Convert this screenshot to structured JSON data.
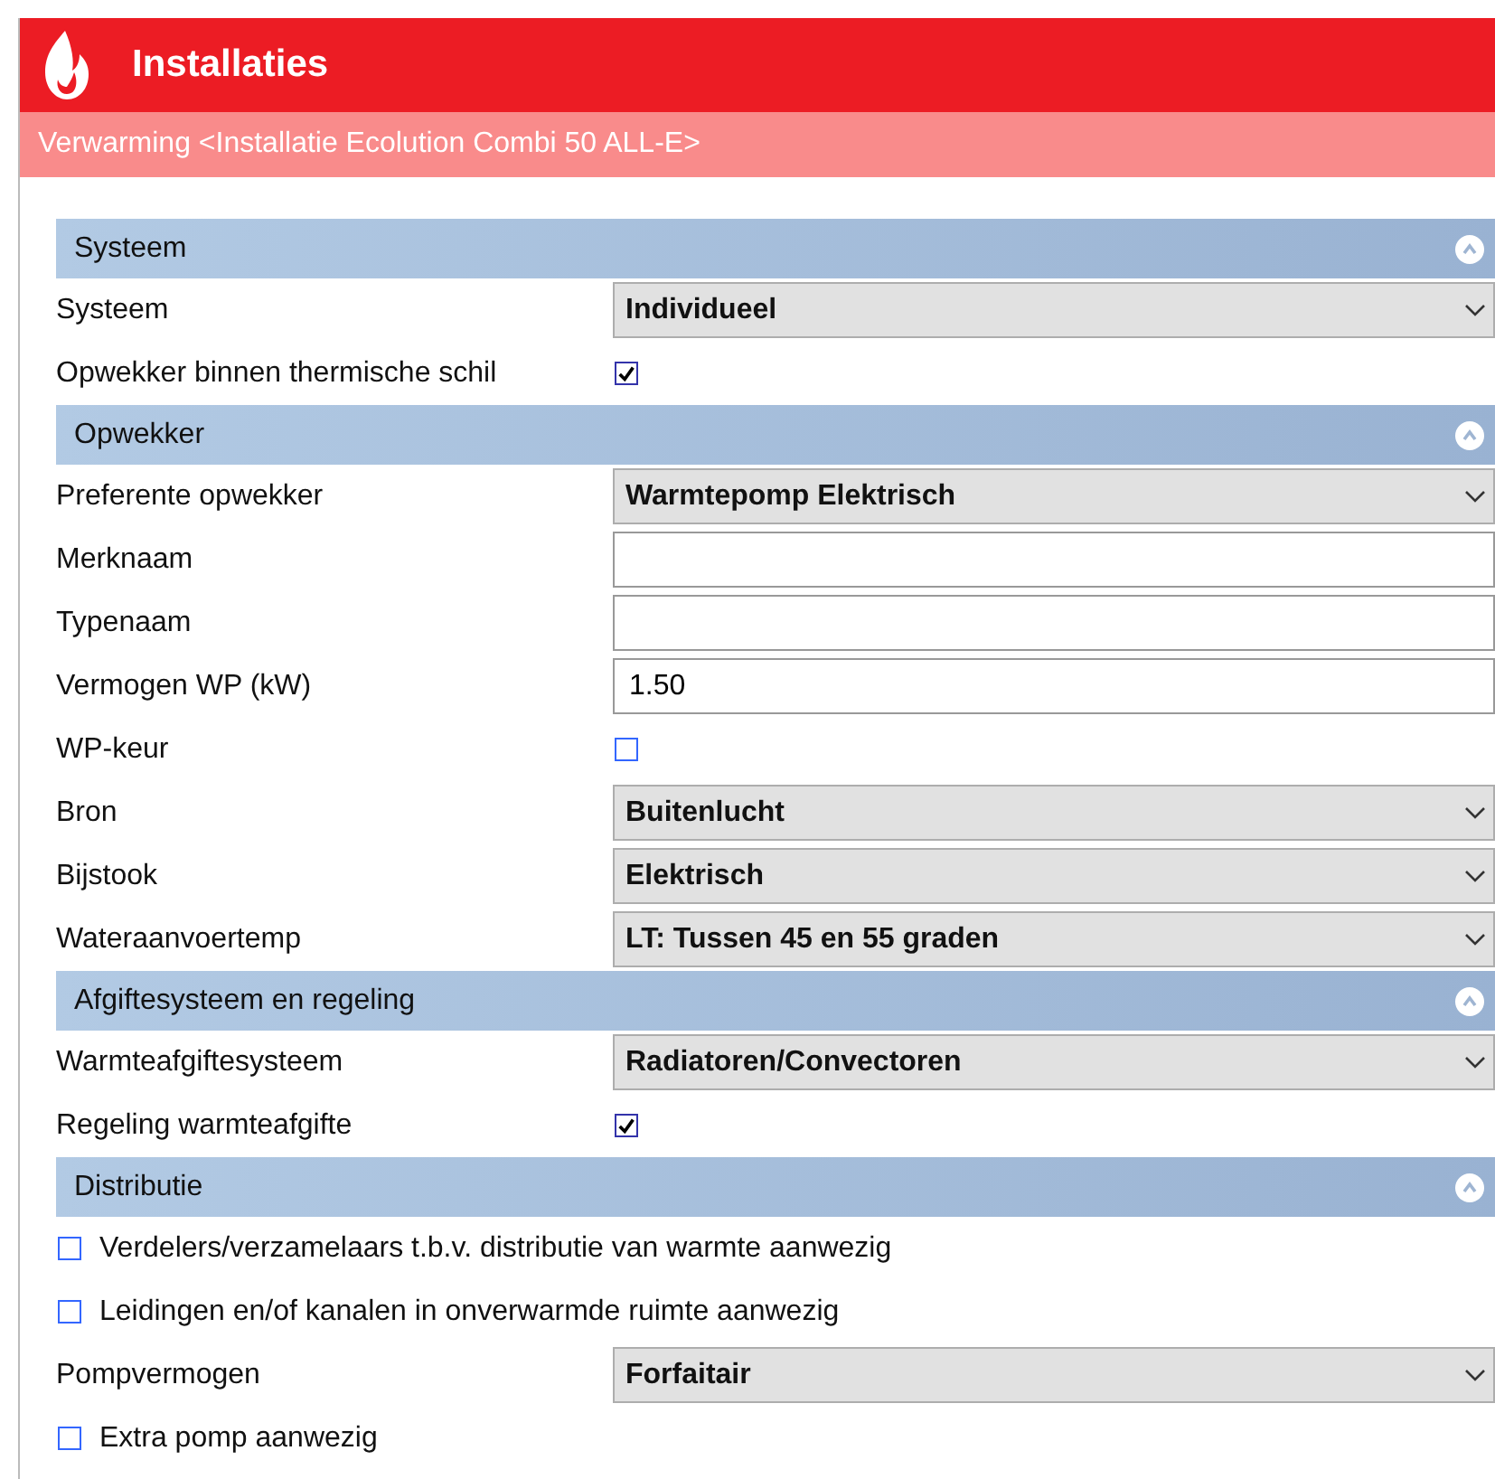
{
  "window": {
    "title": "Installaties",
    "subtitle": "Verwarming <Installatie Ecolution Combi 50 ALL-E>"
  },
  "sections": [
    {
      "title": "Systeem",
      "expanded": true,
      "rows": [
        {
          "kind": "select",
          "label": "Systeem",
          "value": "Individueel"
        },
        {
          "kind": "checkbox",
          "label": "Opwekker binnen thermische schil",
          "checked": true
        }
      ]
    },
    {
      "title": "Opwekker",
      "expanded": true,
      "rows": [
        {
          "kind": "select",
          "label": "Preferente opwekker",
          "value": "Warmtepomp Elektrisch"
        },
        {
          "kind": "input",
          "label": "Merknaam"
        },
        {
          "kind": "input",
          "label": "Typenaam"
        },
        {
          "kind": "input",
          "label": "Vermogen WP (kW)",
          "value": "1.50"
        },
        {
          "kind": "checkbox",
          "label": "WP-keur",
          "checked": false
        },
        {
          "kind": "select",
          "label": "Bron",
          "value": "Buitenlucht"
        },
        {
          "kind": "select",
          "label": "Bijstook",
          "value": "Elektrisch"
        },
        {
          "kind": "select",
          "label": "Wateraanvoertemp",
          "value": "LT: Tussen 45 en 55 graden"
        }
      ]
    },
    {
      "title": "Afgiftesysteem en regeling",
      "expanded": true,
      "rows": [
        {
          "kind": "select",
          "label": "Warmteafgiftesysteem",
          "value": "Radiatoren/Convectoren"
        },
        {
          "kind": "checkbox",
          "label": "Regeling warmteafgifte",
          "checked": true
        }
      ]
    },
    {
      "title": "Distributie",
      "expanded": true,
      "rows": [
        {
          "kind": "inline-checkbox",
          "label": "Verdelers/verzamelaars t.b.v. distributie van warmte aanwezig",
          "checked": false
        },
        {
          "kind": "inline-checkbox",
          "label": "Leidingen en/of kanalen in onverwarmde ruimte aanwezig",
          "checked": false
        },
        {
          "kind": "select",
          "label": "Pompvermogen",
          "value": "Forfaitair"
        },
        {
          "kind": "inline-checkbox",
          "label": "Extra pomp aanwezig",
          "checked": false
        }
      ]
    }
  ]
}
